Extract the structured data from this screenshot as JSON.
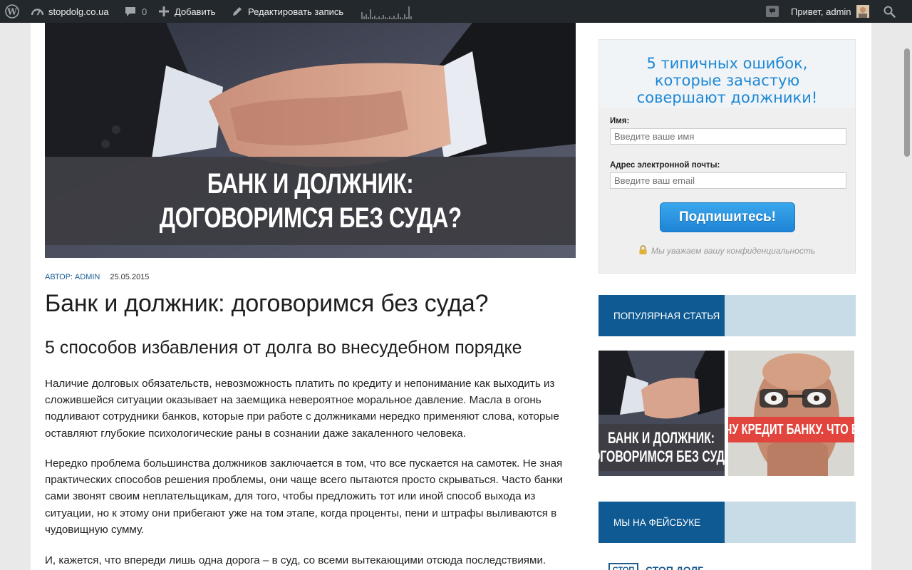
{
  "admin_bar": {
    "site_name": "stopdolg.co.ua",
    "comments_count": "0",
    "add_label": "Добавить",
    "edit_label": "Редактировать запись",
    "greeting": "Привет, admin",
    "icons": [
      "wordpress-logo-icon",
      "dashboard-icon",
      "comment-icon",
      "plus-icon",
      "pencil-icon",
      "stats-sparkline-icon",
      "notification-icon",
      "avatar",
      "search-icon"
    ]
  },
  "hero": {
    "caption_line1": "БАНК И ДОЛЖНИК:",
    "caption_line2": "ДОГОВОРИМСЯ БЕЗ СУДА?"
  },
  "article": {
    "author": "Автор: admin",
    "date": "25.05.2015",
    "title": "Банк и должник: договоримся без суда?",
    "subtitle": "5 способов избавления от долга во внесудебном порядке",
    "paragraphs": [
      "Наличие долговых обязательств, невозможность платить по кредиту и непонимание как выходить из сложившейся ситуации оказывает на заемщика невероятное моральное давление. Масла в огонь подливают сотрудники банков, которые при работе с должниками нередко применяют слова, которые оставляют глубокие психологические раны в сознании даже закаленного человека.",
      "Нередко проблема большинства должников заключается в том, что все пускается на самотек. Не зная практических способов решения проблемы, они чаще всего пытаются просто скрываться. Часто банки сами звонят своим неплательщикам, для того, чтобы предложить тот или иной способ выхода из ситуации, но к этому они прибегают уже на том этапе, когда проценты, пени и штрафы выливаются в чудовищную сумму.",
      "И, кажется, что  впереди лишь одна дорога – в суд, со всеми вытекающими отсюда последствиями."
    ]
  },
  "optin": {
    "heading_lines": [
      "5 типичных ошибок,",
      "которые зачастую",
      "совершают должники!"
    ],
    "name_label": "Имя:",
    "name_placeholder": "Введите ваше имя",
    "email_label": "Адрес электронной почты:",
    "email_placeholder": "Введите ваш email",
    "button_label": "Подпишитесь!",
    "privacy_text": "Мы уважаем вашу конфиденциальность",
    "accent_color": "#1d87d5"
  },
  "popular": {
    "heading": "Популярная статья",
    "thumb1_line1": "БАНК И ДОЛЖНИК:",
    "thumb1_line2": "ДОГОВОРИМСЯ БЕЗ СУДА?",
    "thumb2_caption": "АЧУ КРЕДИТ БАНКУ. ЧТО БУ"
  },
  "facebook": {
    "heading": "Мы на Фейсбуке",
    "logo_text": "СТОП",
    "page_name": "СТОП ДОЛГ"
  },
  "colors": {
    "admin_bar_bg": "#23282d",
    "widget_tab": "#0f5a93",
    "widget_bar": "#c8dce8",
    "link": "#1c5f95"
  }
}
